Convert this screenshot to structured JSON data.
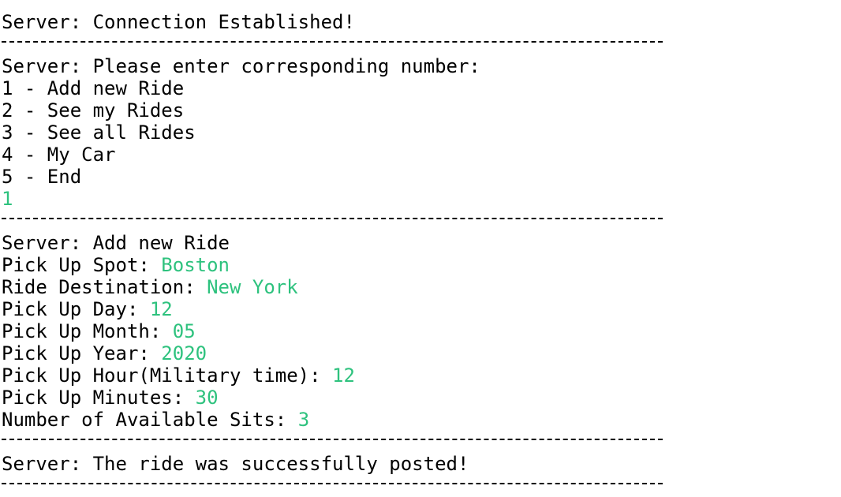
{
  "colors": {
    "background": "#ffffff",
    "text": "#000000",
    "user_input": "#2ec27e"
  },
  "terminal": {
    "connection_message": "Server: Connection Established!",
    "menu_prompt": "Server: Please enter corresponding number:",
    "menu_items": [
      "1 - Add new Ride",
      "2 - See my Rides",
      "3 - See all Rides",
      "4 - My Car",
      "5 - End"
    ],
    "menu_choice": "1",
    "add_ride_header": "Server: Add new Ride",
    "fields": [
      {
        "label": "Pick Up Spot: ",
        "value": "Boston"
      },
      {
        "label": "Ride Destination: ",
        "value": "New York"
      },
      {
        "label": "Pick Up Day: ",
        "value": "12"
      },
      {
        "label": "Pick Up Month: ",
        "value": "05"
      },
      {
        "label": "Pick Up Year: ",
        "value": "2020"
      },
      {
        "label": "Pick Up Hour(Military time): ",
        "value": "12"
      },
      {
        "label": "Pick Up Minutes: ",
        "value": "30"
      },
      {
        "label": "Number of Available Sits: ",
        "value": "3"
      }
    ],
    "success_message": "Server: The ride was successfully posted!"
  }
}
